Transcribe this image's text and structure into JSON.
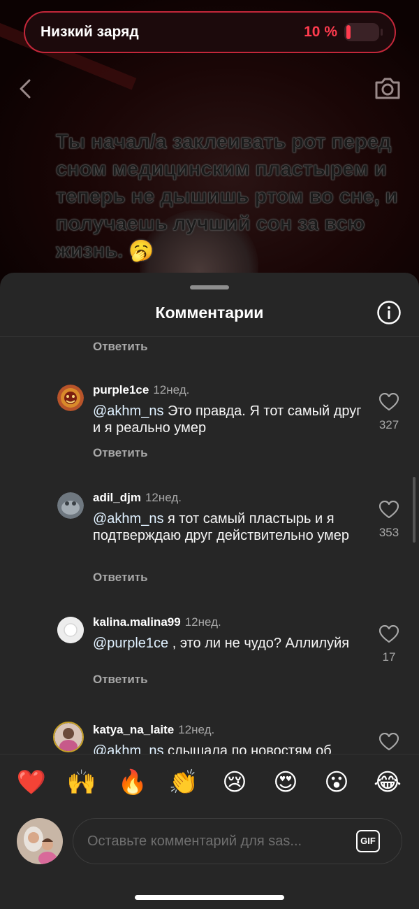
{
  "battery": {
    "label": "Низкий заряд",
    "percent": "10 %"
  },
  "story": {
    "caption": "Ты начал/а заклеивать рот перед сном медицинским пластырем и теперь не дышишь ртом во сне, и получаешь лучший сон за всю жизнь. 🥱"
  },
  "sheet": {
    "title": "Комментарии",
    "reply_label": "Ответить"
  },
  "comments": [
    {
      "username": "purple1ce",
      "time": "12нед.",
      "mention": "@akhm_ns",
      "text": " Это правда. Я тот самый друг и я реально умер",
      "likes": "327"
    },
    {
      "username": "adil_djm",
      "time": "12нед.",
      "mention": "@akhm_ns",
      "text": " я тот самый пластырь и я подтверждаю друг действительно умер",
      "likes": "353"
    },
    {
      "username": "kalina.malina99",
      "time": "12нед.",
      "mention": "@purple1ce",
      "text": " , это ли не чудо? Аллилуйя",
      "likes": "17"
    },
    {
      "username": "katya_na_laite",
      "time": "12нед.",
      "mention": "@akhm_ns",
      "text": " слышала по новостям об",
      "likes": ""
    }
  ],
  "emojis": [
    "❤️",
    "🙌",
    "🔥",
    "👏",
    "😢",
    "😍",
    "😮",
    "😂"
  ],
  "composer": {
    "placeholder": "Оставьте комментарий для sas...",
    "gif_label": "GIF"
  },
  "colors": {
    "sheet_bg": "#262626",
    "battery_red": "#ff3b4e",
    "secondary_text": "#a8a8a8"
  }
}
